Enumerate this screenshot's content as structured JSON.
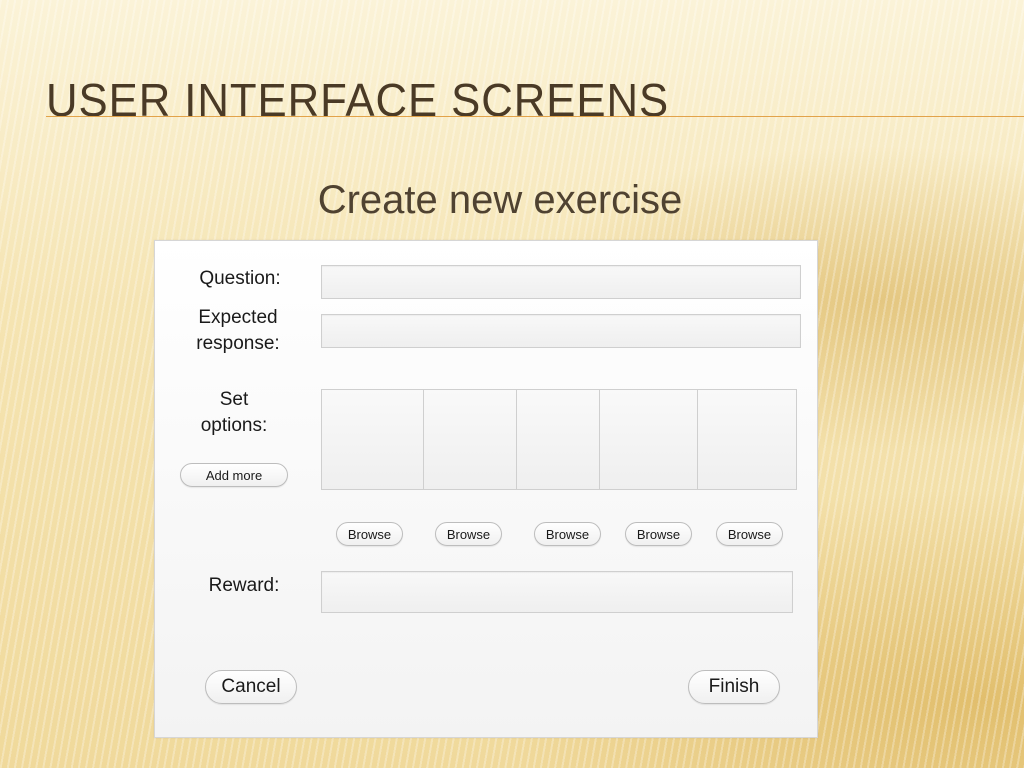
{
  "slide": {
    "title": "USER INTERFACE SCREENS",
    "screen_title": "Create new exercise"
  },
  "form": {
    "question_label": "Question:",
    "expected_label_line1": "Expected",
    "expected_label_line2": "response:",
    "set_options_label_line1": "Set",
    "set_options_label_line2": "options:",
    "add_more_label": "Add more",
    "option_count": 5,
    "browse_labels": [
      "Browse",
      "Browse",
      "Browse",
      "Browse",
      "Browse"
    ],
    "reward_label": "Reward:",
    "cancel_label": "Cancel",
    "finish_label": "Finish",
    "question_value": "",
    "expected_value": "",
    "reward_value": ""
  },
  "colors": {
    "accent_rule": "#e2a34a",
    "title_text": "#4a3a26"
  }
}
